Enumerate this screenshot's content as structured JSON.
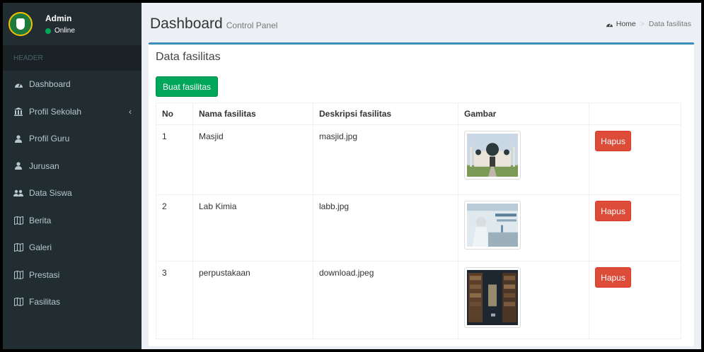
{
  "user": {
    "name": "Admin",
    "status": "Online"
  },
  "sidebar": {
    "header": "HEADER",
    "items": [
      {
        "label": "Dashboard",
        "icon": "dashboard-icon"
      },
      {
        "label": "Profil Sekolah",
        "icon": "institution-icon"
      },
      {
        "label": "Profil Guru",
        "icon": "user-icon"
      },
      {
        "label": "Jurusan",
        "icon": "user-icon"
      },
      {
        "label": "Data Siswa",
        "icon": "users-icon"
      },
      {
        "label": "Berita",
        "icon": "map-icon"
      },
      {
        "label": "Galeri",
        "icon": "map-icon"
      },
      {
        "label": "Prestasi",
        "icon": "map-icon"
      },
      {
        "label": "Fasilitas",
        "icon": "map-icon"
      }
    ]
  },
  "header": {
    "title": "Dashboard",
    "subtitle": "Control Panel",
    "breadcrumb": {
      "home": "Home",
      "current": "Data fasilitas"
    }
  },
  "box": {
    "title": "Data fasilitas",
    "create_label": "Buat fasilitas",
    "columns": [
      "No",
      "Nama fasilitas",
      "Deskripsi fasilitas",
      "Gambar",
      ""
    ],
    "rows": [
      {
        "no": "1",
        "name": "Masjid",
        "desc": "masjid.jpg",
        "action": "Hapus"
      },
      {
        "no": "2",
        "name": "Lab Kimia",
        "desc": "labb.jpg",
        "action": "Hapus"
      },
      {
        "no": "3",
        "name": "perpustakaan",
        "desc": "download.jpeg",
        "action": "Hapus"
      }
    ]
  },
  "colors": {
    "sidebar": "#222d32",
    "primary": "#3c8dbc",
    "success": "#00a65a",
    "danger": "#dd4b39"
  }
}
